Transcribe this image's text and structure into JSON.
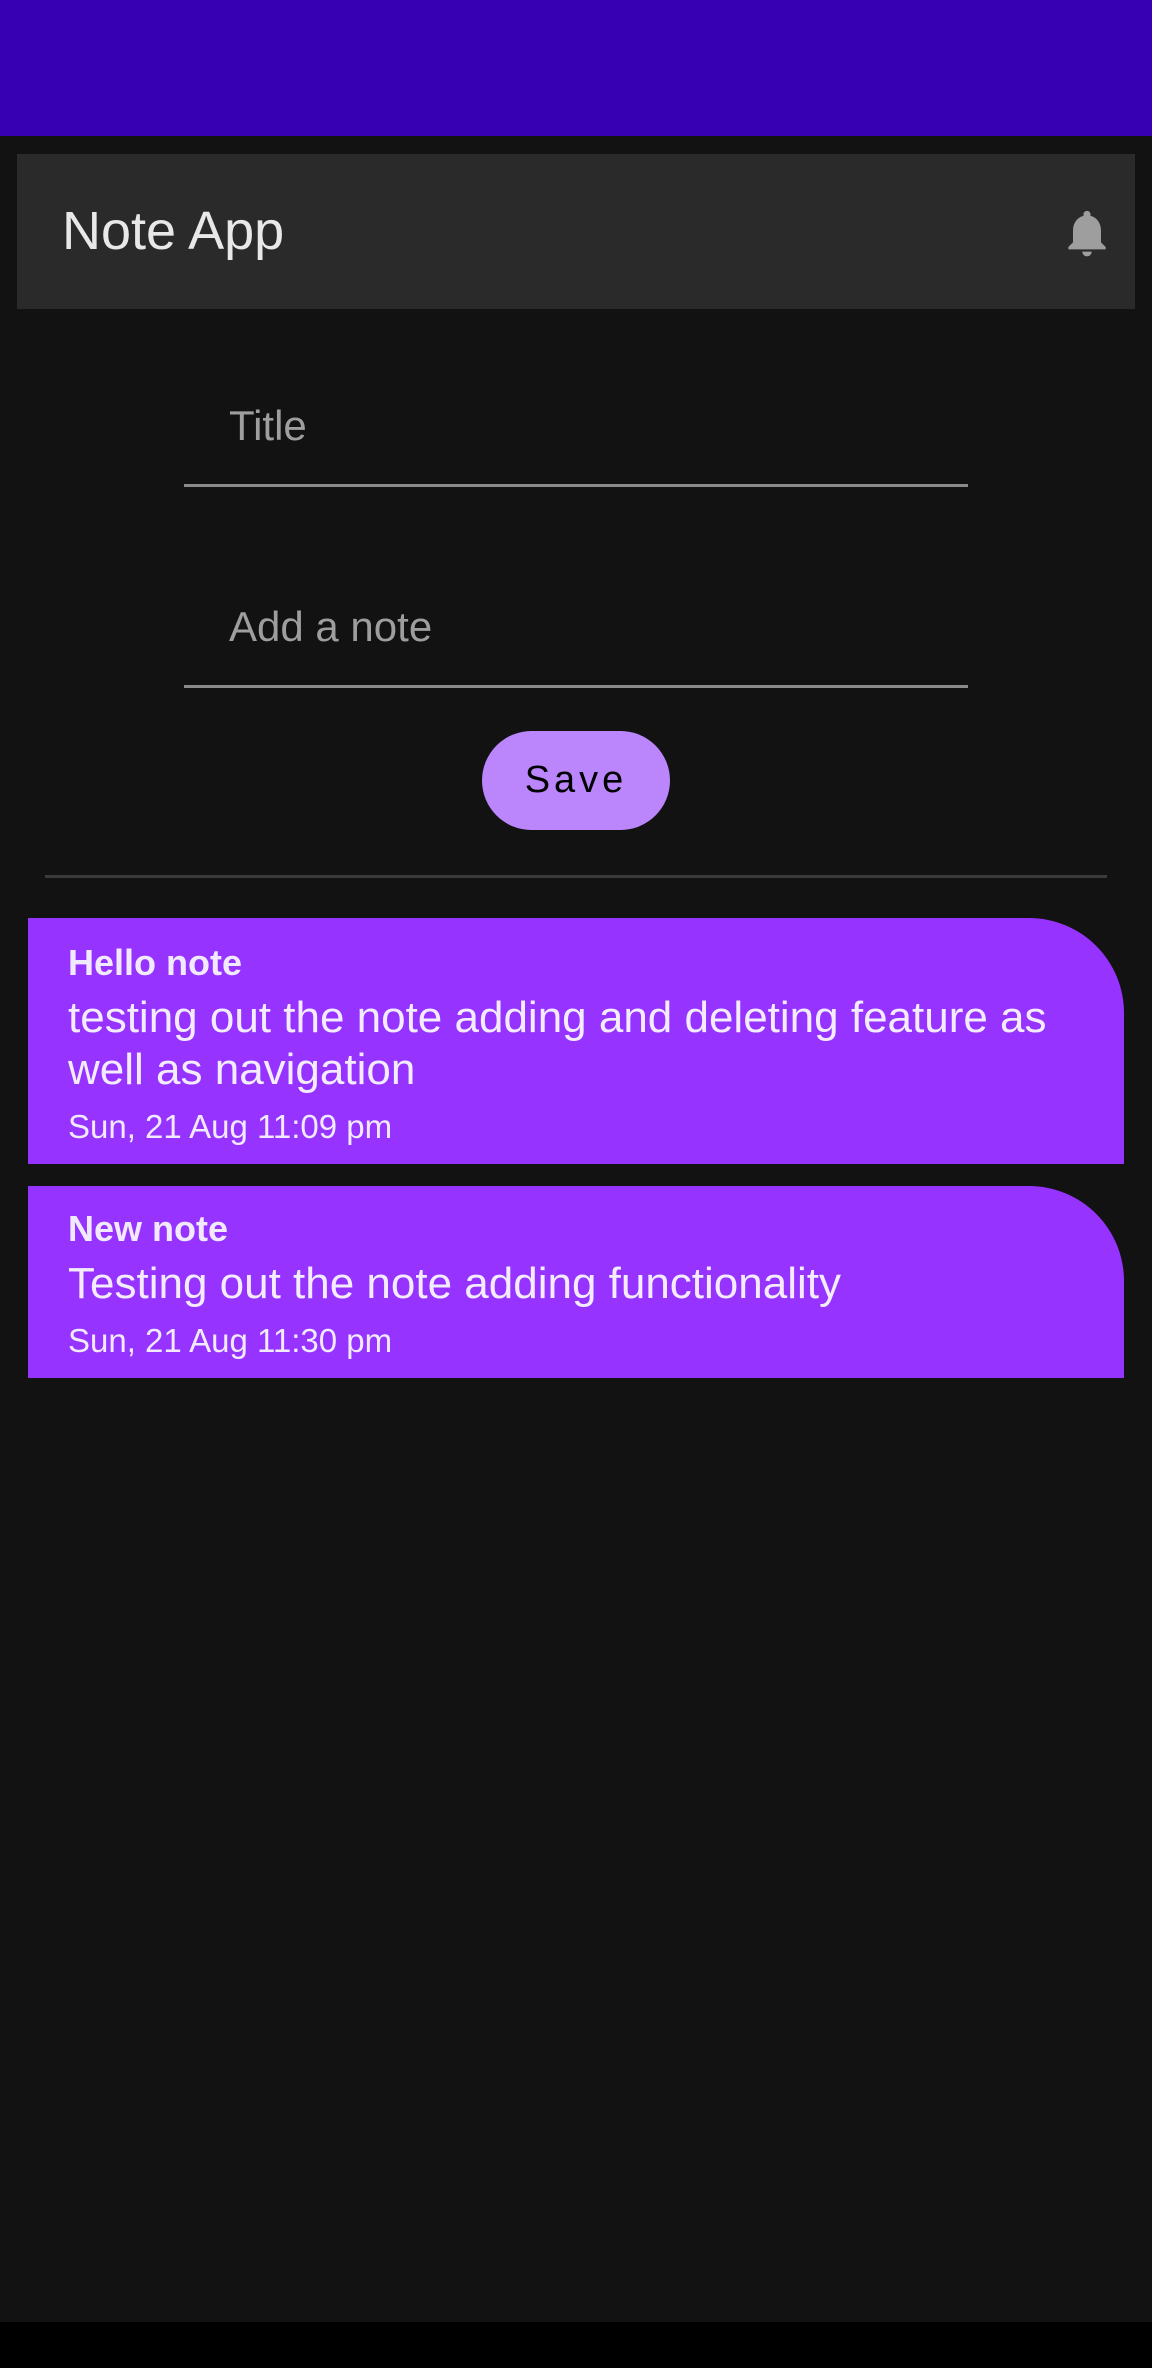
{
  "app_bar": {
    "title": "Note App",
    "icon": "bell-icon"
  },
  "form": {
    "title_placeholder": "Title",
    "note_placeholder": "Add a note",
    "title_value": "",
    "note_value": "",
    "save_label": "Save"
  },
  "notes": [
    {
      "title": "Hello note",
      "body": "testing out the note adding and deleting feature as well as navigation",
      "date": "Sun, 21 Aug 11:09 pm"
    },
    {
      "title": "New note",
      "body": "Testing out the note adding functionality",
      "date": "Sun, 21 Aug 11:30 pm"
    }
  ],
  "colors": {
    "status_bar": "#3700b3",
    "app_bar": "#2a2a2a",
    "background": "#121212",
    "save_button": "#bb86fc",
    "note_card": "#9633ff"
  }
}
